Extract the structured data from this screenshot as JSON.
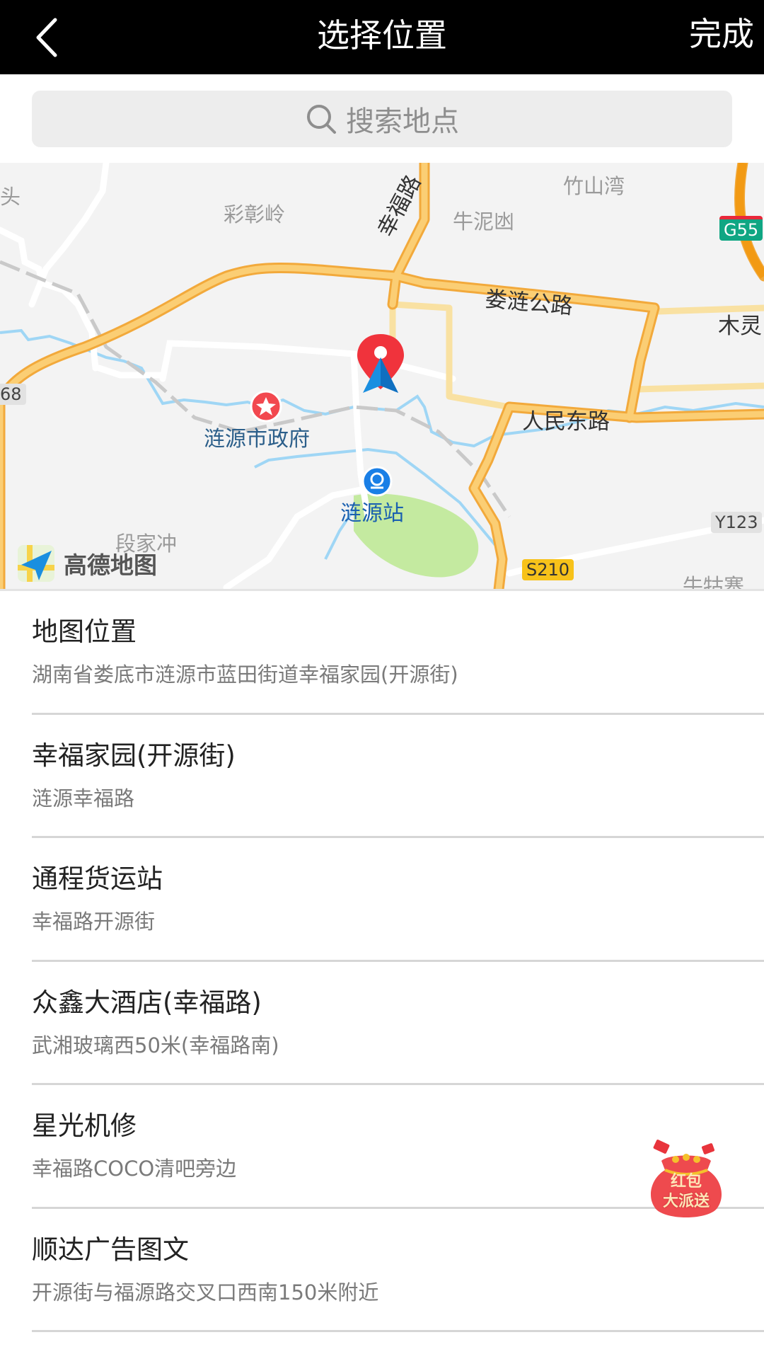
{
  "header": {
    "back_icon": "chevron-left-icon",
    "title": "选择位置",
    "done_label": "完成"
  },
  "search": {
    "icon": "search-icon",
    "placeholder": "搜索地点"
  },
  "map": {
    "provider_logo": "高德地图",
    "place_labels": [
      "彩彰岭",
      "竹山湾",
      "牛泥凼",
      "段家冲",
      "牛牯寨",
      "头"
    ],
    "road_labels": [
      "幸福路",
      "娄涟公路",
      "人民东路",
      "木灵"
    ],
    "poi_labels": [
      "涟源市政府",
      "涟源站"
    ],
    "route_shields": [
      "G55",
      "S210",
      "Y123",
      "68"
    ],
    "markers": [
      "location-pin-icon",
      "navigation-arrow-icon",
      "government-star-icon",
      "train-station-icon"
    ]
  },
  "colors": {
    "header_bg": "#000000",
    "map_bg": "#f3f3f3",
    "main_road": "#f7c15a",
    "pin_red": "#f0333c",
    "nav_blue": "#1a8fe0",
    "water": "#9fd6f5",
    "park": "#c4eaa0"
  },
  "list": [
    {
      "title": "地图位置",
      "subtitle": "湖南省娄底市涟源市蓝田街道幸福家园(开源街)"
    },
    {
      "title": "幸福家园(开源街)",
      "subtitle": "涟源幸福路"
    },
    {
      "title": "通程货运站",
      "subtitle": "幸福路开源街"
    },
    {
      "title": "众鑫大酒店(幸福路)",
      "subtitle": "武湘玻璃西50米(幸福路南)"
    },
    {
      "title": "星光机修",
      "subtitle": "幸福路COCO清吧旁边"
    },
    {
      "title": "顺达广告图文",
      "subtitle": "开源街与福源路交叉口西南150米附近"
    }
  ],
  "promo": {
    "line1": "红包",
    "line2": "大派送"
  }
}
